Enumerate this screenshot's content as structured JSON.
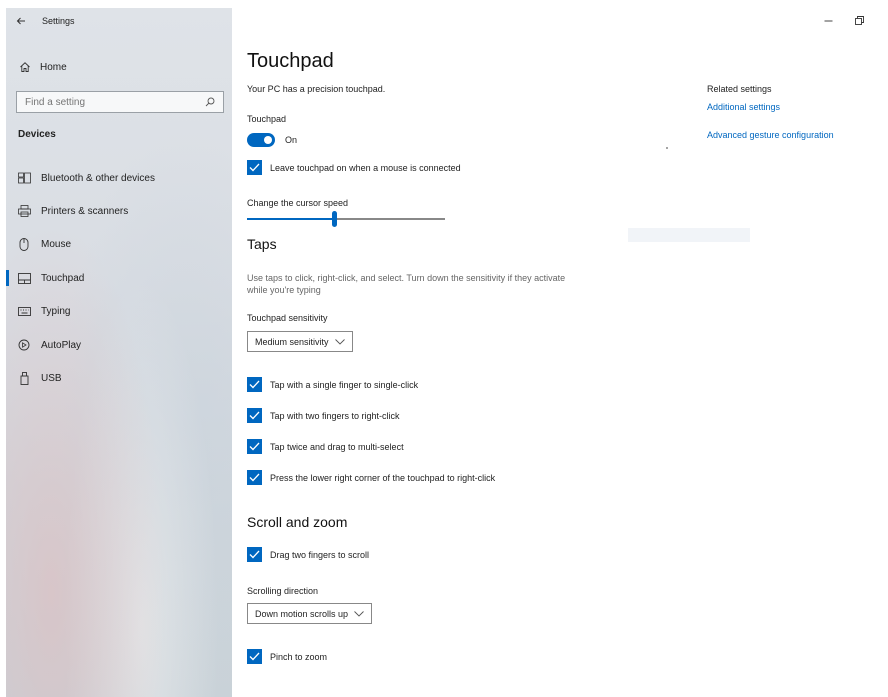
{
  "window": {
    "title": "Settings"
  },
  "sidebar": {
    "home_label": "Home",
    "search_placeholder": "Find a setting",
    "section_title": "Devices",
    "items": [
      {
        "label": "Bluetooth & other devices",
        "icon": "bluetooth-keyboard-icon"
      },
      {
        "label": "Printers & scanners",
        "icon": "printer-icon"
      },
      {
        "label": "Mouse",
        "icon": "mouse-icon"
      },
      {
        "label": "Touchpad",
        "icon": "touchpad-icon",
        "active": true
      },
      {
        "label": "Typing",
        "icon": "keyboard-icon"
      },
      {
        "label": "AutoPlay",
        "icon": "autoplay-icon"
      },
      {
        "label": "USB",
        "icon": "usb-icon"
      }
    ]
  },
  "main": {
    "title": "Touchpad",
    "precision_note": "Your PC has a precision touchpad.",
    "touchpad_label": "Touchpad",
    "touchpad_toggle": {
      "state_text": "On",
      "on": true
    },
    "leave_on_checkbox": {
      "label": "Leave touchpad on when a mouse is connected",
      "checked": true
    },
    "cursor_speed": {
      "label": "Change the cursor speed",
      "value_fraction": 0.44
    },
    "taps": {
      "heading": "Taps",
      "description": "Use taps to click, right-click, and select. Turn down the sensitivity if they activate while you're typing",
      "sensitivity_label": "Touchpad sensitivity",
      "sensitivity_value": "Medium sensitivity",
      "options": [
        {
          "label": "Tap with a single finger to single-click",
          "checked": true
        },
        {
          "label": "Tap with two fingers to right-click",
          "checked": true
        },
        {
          "label": "Tap twice and drag to multi-select",
          "checked": true
        },
        {
          "label": "Press the lower right corner of the touchpad to right-click",
          "checked": true
        }
      ]
    },
    "scroll_zoom": {
      "heading": "Scroll and zoom",
      "drag_scroll": {
        "label": "Drag two fingers to scroll",
        "checked": true
      },
      "direction_label": "Scrolling direction",
      "direction_value": "Down motion scrolls up",
      "pinch_zoom": {
        "label": "Pinch to zoom",
        "checked": true
      }
    }
  },
  "related": {
    "heading": "Related settings",
    "links": [
      "Additional settings",
      "Advanced gesture configuration"
    ]
  },
  "colors": {
    "accent": "#0067c0"
  }
}
